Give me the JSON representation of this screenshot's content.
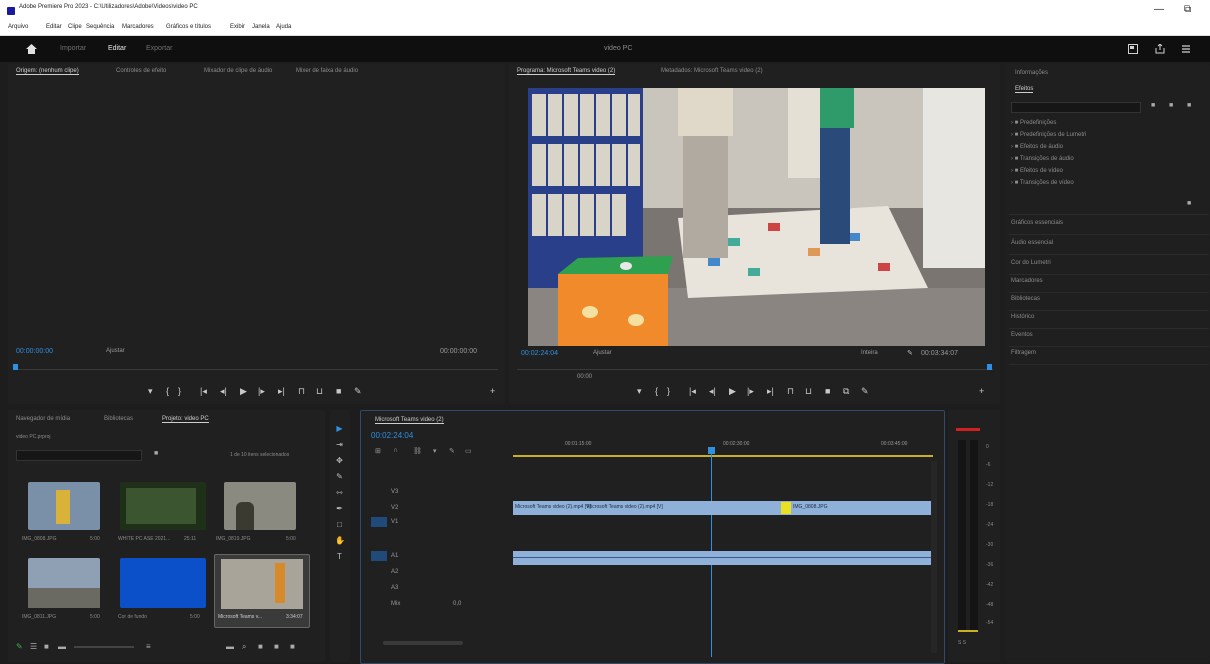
{
  "window": {
    "title": "Adobe Premiere Pro 2023 - C:\\Utilizadores\\Adobe\\Videos\\video PC",
    "controls": [
      "—",
      "⧉"
    ]
  },
  "menubar": [
    "Arquivo",
    "Editar",
    "Clipe",
    "Sequência",
    "Marcadores",
    "Gráficos e títulos",
    "Exibir",
    "Janela",
    "Ajuda"
  ],
  "workspace": {
    "home_icon": "home-icon",
    "tabs": [
      "Importar",
      "Editar",
      "Exportar"
    ],
    "active_tab": "Editar",
    "project_name": "video PC",
    "right_icons": [
      "quick-export-icon",
      "share-icon",
      "menu-icon"
    ]
  },
  "source_monitor": {
    "tabs": [
      "Origem: (nenhum clipe)",
      "Controles de efeito",
      "Mixador de clipe de áudio",
      "Mixer de faixa de áudio"
    ],
    "timecode_in": "00:00:00:00",
    "fit": "Ajustar",
    "timecode_out": "00:00:00:00"
  },
  "program_monitor": {
    "tabs": [
      "Programa: Microsoft Teams video (2)",
      "Metadados: Microsoft Teams video (2)"
    ],
    "timecode": "00:02:24:04",
    "fit": "Ajustar",
    "quality": "Inteira",
    "duration": "00:03:34:07",
    "ruler_label": "00:00"
  },
  "effects": {
    "title": "Informações",
    "tab": "Efeitos",
    "tree": [
      "Predefinições",
      "Predefinições de Lumetri",
      "Efeitos de áudio",
      "Transições de áudio",
      "Efeitos de vídeo",
      "Transições de vídeo"
    ],
    "panels": [
      "Gráficos essenciais",
      "Áudio essencial",
      "Cor do Lumetri",
      "Marcadores",
      "Bibliotecas",
      "Histórico",
      "Eventos",
      "Filtragem"
    ]
  },
  "project": {
    "tabs": [
      "Navegador de mídia",
      "Bibliotecas",
      "Projeto: video PC"
    ],
    "file": "video PC.prproj",
    "search_placeholder": "",
    "count": "1 de 10 itens selecionados",
    "clips": [
      {
        "name": "IMG_0808.JPG",
        "dur": "5:00",
        "color": "#7a8fa8"
      },
      {
        "name": "WHITE PC ASE 2021...",
        "dur": "25:11",
        "color": "#3a5530"
      },
      {
        "name": "IMG_0819.JPG",
        "dur": "5:00",
        "color": "#8a8a80"
      },
      {
        "name": "IMG_0811.JPG",
        "dur": "5:00",
        "color": "#8fa0b5"
      },
      {
        "name": "Cor de fundo",
        "dur": "5:00",
        "color": "#0b4fc9"
      },
      {
        "name": "Microsoft Teams v...",
        "dur": "3:34:07",
        "color": "#a9a49a"
      }
    ]
  },
  "timeline": {
    "tab": "Microsoft Teams video (2)",
    "timecode": "00:02:24:04",
    "ruler": [
      "00:01:15:00",
      "00:02:30:00",
      "00:03:45:00"
    ],
    "video_tracks": [
      "V3",
      "V2",
      "V1"
    ],
    "audio_tracks": [
      "A1",
      "A2",
      "A3"
    ],
    "mix_label": "Mix",
    "mix_value": "0,0",
    "clip_v1": "Microsoft Teams video (2).mp4 [V]",
    "clip_v1b": "Microsoft Teams video (2).mp4 [V]",
    "clip_v1c": "IMG_0808.JPG",
    "audio_meter_labels": [
      "0",
      "-6",
      "-12",
      "-18",
      "-24",
      "-30",
      "-36",
      "-42",
      "-48",
      "-54"
    ],
    "meter_solo": "S  S"
  },
  "status": ""
}
